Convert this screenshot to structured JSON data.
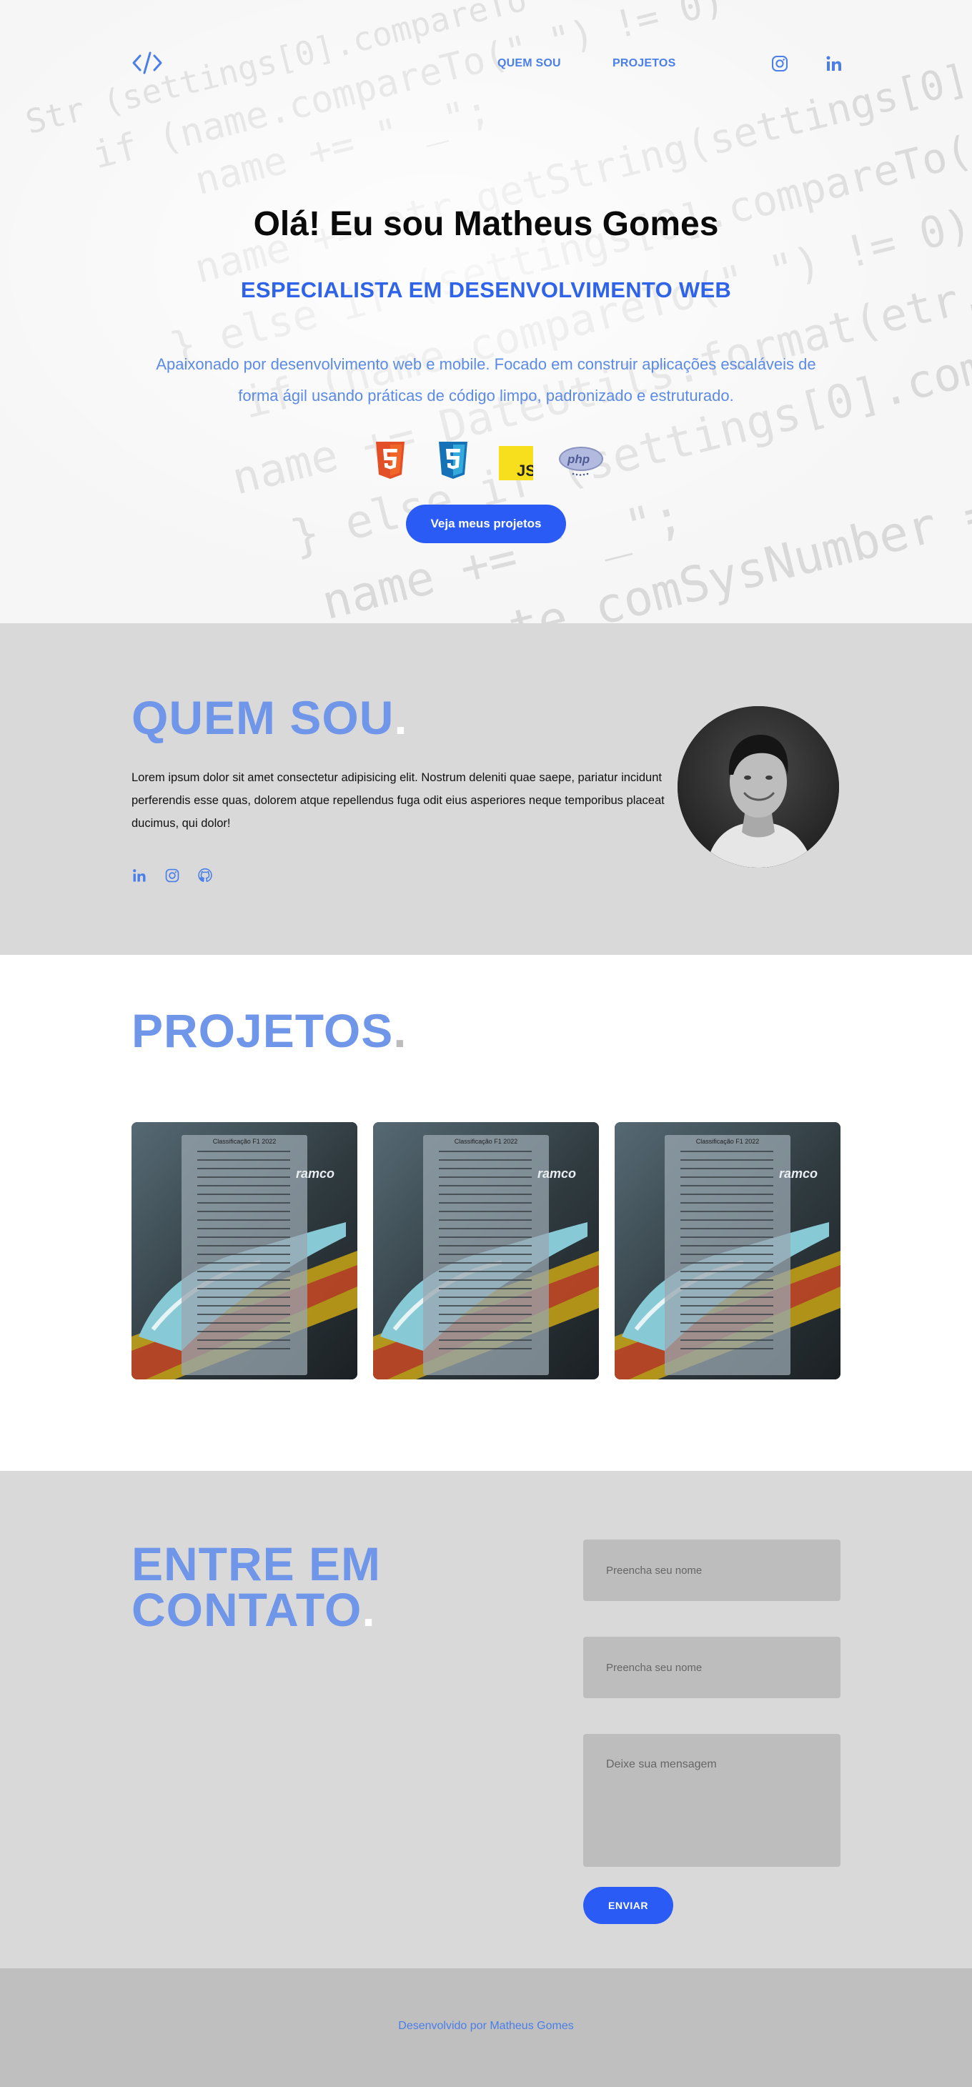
{
  "colors": {
    "accent": "#2a5cf5",
    "link": "#4a7ee8",
    "title_light": "#6f96e8",
    "section_gray": "#d9d9d9",
    "footer_gray": "#bfbfbf",
    "input_gray": "#bdbdbd"
  },
  "nav": {
    "logo_icon": "code-brackets-icon",
    "links": [
      {
        "label": "QUEM SOU"
      },
      {
        "label": "PROJETOS"
      }
    ],
    "icons": [
      "instagram-icon",
      "linkedin-icon"
    ]
  },
  "hero": {
    "title": "Olá! Eu sou Matheus Gomes",
    "subtitle": "ESPECIALISTA EM DESENVOLVIMENTO WEB",
    "description_line1": "Apaixonado por desenvolvimento web e mobile. Focado em construir aplicações escaláveis de",
    "description_line2": "forma ágil usando práticas de código limpo, padronizado e estruturado.",
    "tech_icons": [
      "html5-icon",
      "css3-icon",
      "javascript-icon",
      "php-icon"
    ],
    "cta_label": "Veja meus projetos"
  },
  "about": {
    "title": "QUEM SOU",
    "dot": ".",
    "text": "Lorem ipsum dolor sit amet consectetur adipisicing elit. Nostrum deleniti quae saepe, pariatur incidunt perferendis esse quas, dolorem atque repellendus fuga odit eius asperiores neque temporibus placeat ducimus, qui dolor!",
    "social_icons": [
      "linkedin-icon",
      "instagram-icon",
      "github-icon"
    ]
  },
  "projects": {
    "title": "PROJETOS",
    "dot": ".",
    "cards": [
      {
        "table_title": "Classificação F1 2022"
      },
      {
        "table_title": "Classificação F1 2022"
      },
      {
        "table_title": "Classificação F1 2022"
      }
    ]
  },
  "contact": {
    "title_line1": "ENTRE EM",
    "title_line2": "CONTATO",
    "dot": ".",
    "name_placeholder_1": "Preencha seu nome",
    "name_placeholder_2": "Preencha seu nome",
    "message_placeholder": "Deixe sua mensagem",
    "send_label": "ENVIAR"
  },
  "footer": {
    "text": "Desenvolvido por Matheus Gomes"
  }
}
